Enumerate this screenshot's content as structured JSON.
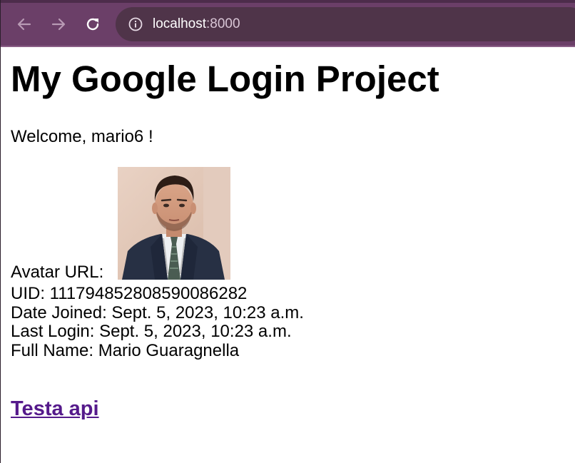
{
  "browser": {
    "url_host": "localhost",
    "url_port": ":8000",
    "icons": {
      "back": "back-arrow-icon",
      "forward": "forward-arrow-icon",
      "reload": "reload-icon",
      "site_info": "info-icon"
    },
    "colors": {
      "toolbar": "#6b3f68",
      "omnibox": "#4f3449"
    }
  },
  "page": {
    "title": "My Google Login Project",
    "welcome": "Welcome, mario6 !",
    "avatar_label": "Avatar URL:",
    "uid": "UID: 111794852808590086282",
    "date_joined": "Date Joined: Sept. 5, 2023, 10:23 a.m.",
    "last_login": "Last Login: Sept. 5, 2023, 10:23 a.m.",
    "full_name": "Full Name: Mario Guaragnella",
    "link_label": "Testa api",
    "link_color": "#551a8b"
  }
}
